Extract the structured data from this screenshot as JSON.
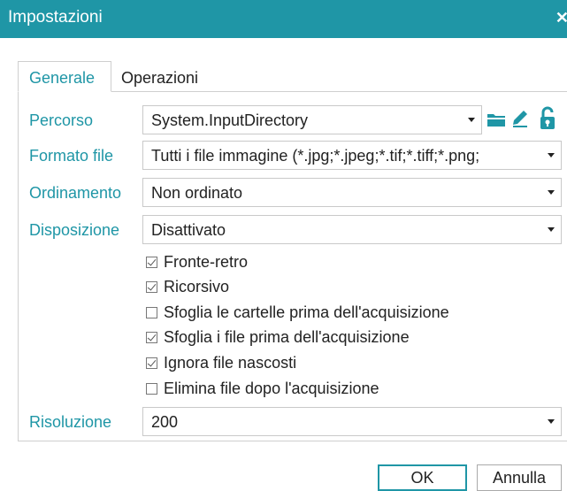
{
  "window": {
    "title": "Impostazioni",
    "close_glyph": "✕"
  },
  "tabs": [
    {
      "label": "Generale",
      "active": true
    },
    {
      "label": "Operazioni",
      "active": false
    }
  ],
  "fields": {
    "percorso": {
      "label": "Percorso",
      "value": "System.InputDirectory"
    },
    "formato": {
      "label": "Formato file",
      "value": "Tutti i file immagine (*.jpg;*.jpeg;*.tif;*.tiff;*.png;"
    },
    "ordinamento": {
      "label": "Ordinamento",
      "value": "Non ordinato"
    },
    "disposizione": {
      "label": "Disposizione",
      "value": "Disattivato"
    },
    "risoluzione": {
      "label": "Risoluzione",
      "value": "200"
    }
  },
  "icons": {
    "folder": "folder-icon",
    "edit": "pencil-icon",
    "lock": "unlock-icon"
  },
  "options": [
    {
      "label": "Fronte-retro",
      "checked": true
    },
    {
      "label": "Ricorsivo",
      "checked": true
    },
    {
      "label": "Sfoglia le cartelle prima dell'acquisizione",
      "checked": false
    },
    {
      "label": "Sfoglia i file prima dell'acquisizione",
      "checked": true
    },
    {
      "label": "Ignora file nascosti",
      "checked": true
    },
    {
      "label": "Elimina file dopo l'acquisizione",
      "checked": false
    }
  ],
  "buttons": {
    "ok": "OK",
    "cancel": "Annulla"
  },
  "colors": {
    "accent": "#1f96a6"
  }
}
